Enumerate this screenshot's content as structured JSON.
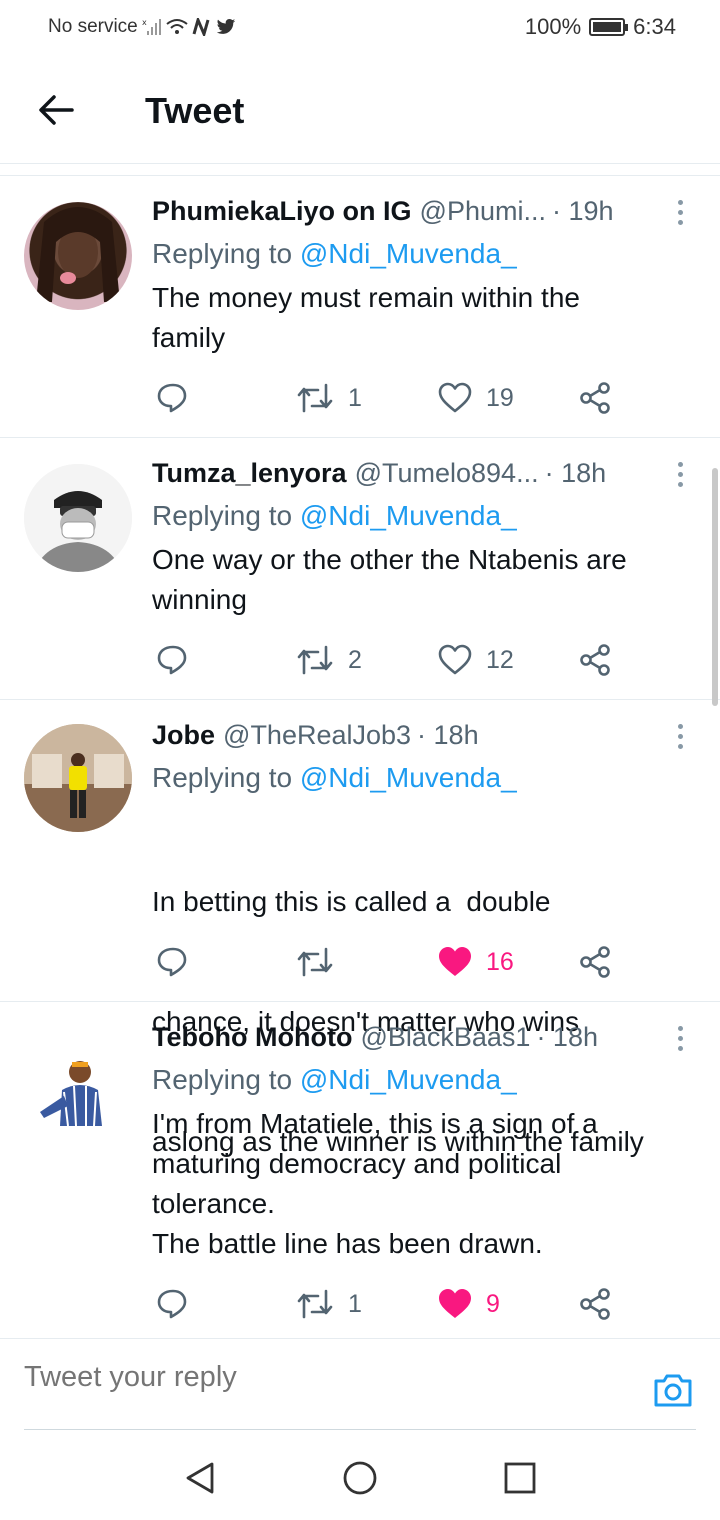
{
  "status_bar": {
    "carrier": "No service",
    "battery": "100%",
    "time": "6:34"
  },
  "header": {
    "title": "Tweet"
  },
  "tweets": [
    {
      "name": "PhumiekaLiyo on IG",
      "handle": "@Phumi...",
      "time": "· 19h",
      "replying_label": "Replying to",
      "replying_to": "@Ndi_Muvenda_",
      "text_lines": [
        "The money must remain within the",
        "family"
      ],
      "reply_count": "",
      "retweet_count": "1",
      "like_count": "19",
      "liked": false
    },
    {
      "name": "Tumza_lenyora",
      "handle": "@Tumelo894...",
      "time": "· 18h",
      "replying_label": "Replying to",
      "replying_to": "@Ndi_Muvenda_",
      "text_lines": [
        "One way or the other the Ntabenis are",
        "winning"
      ],
      "reply_count": "",
      "retweet_count": "2",
      "like_count": "12",
      "liked": false
    },
    {
      "name": "Jobe",
      "handle": "@TheRealJob3",
      "time": "· 18h",
      "replying_label": "Replying to",
      "replying_to": "@Ndi_Muvenda_",
      "text_lines": [
        "In betting this is called a  double",
        "chance, it doesn't matter who wins",
        "aslong as the winner is within the family"
      ],
      "reply_count": "",
      "retweet_count": "",
      "like_count": "16",
      "liked": true
    },
    {
      "name": "Teboho Mohoto",
      "handle": "@BlackBaas1",
      "time": "· 18h",
      "replying_label": "Replying to",
      "replying_to": "@Ndi_Muvenda_",
      "text_lines": [
        "I'm from Matatiele, this is a sign of a",
        "maturing democracy and political",
        "tolerance.",
        "The battle line has been drawn."
      ],
      "reply_count": "",
      "retweet_count": "1",
      "like_count": "9",
      "liked": true
    }
  ],
  "reply_bar": {
    "placeholder": "Tweet your reply"
  },
  "colors": {
    "accent": "#1d9bf0",
    "like": "#f91880",
    "muted": "#536471"
  }
}
